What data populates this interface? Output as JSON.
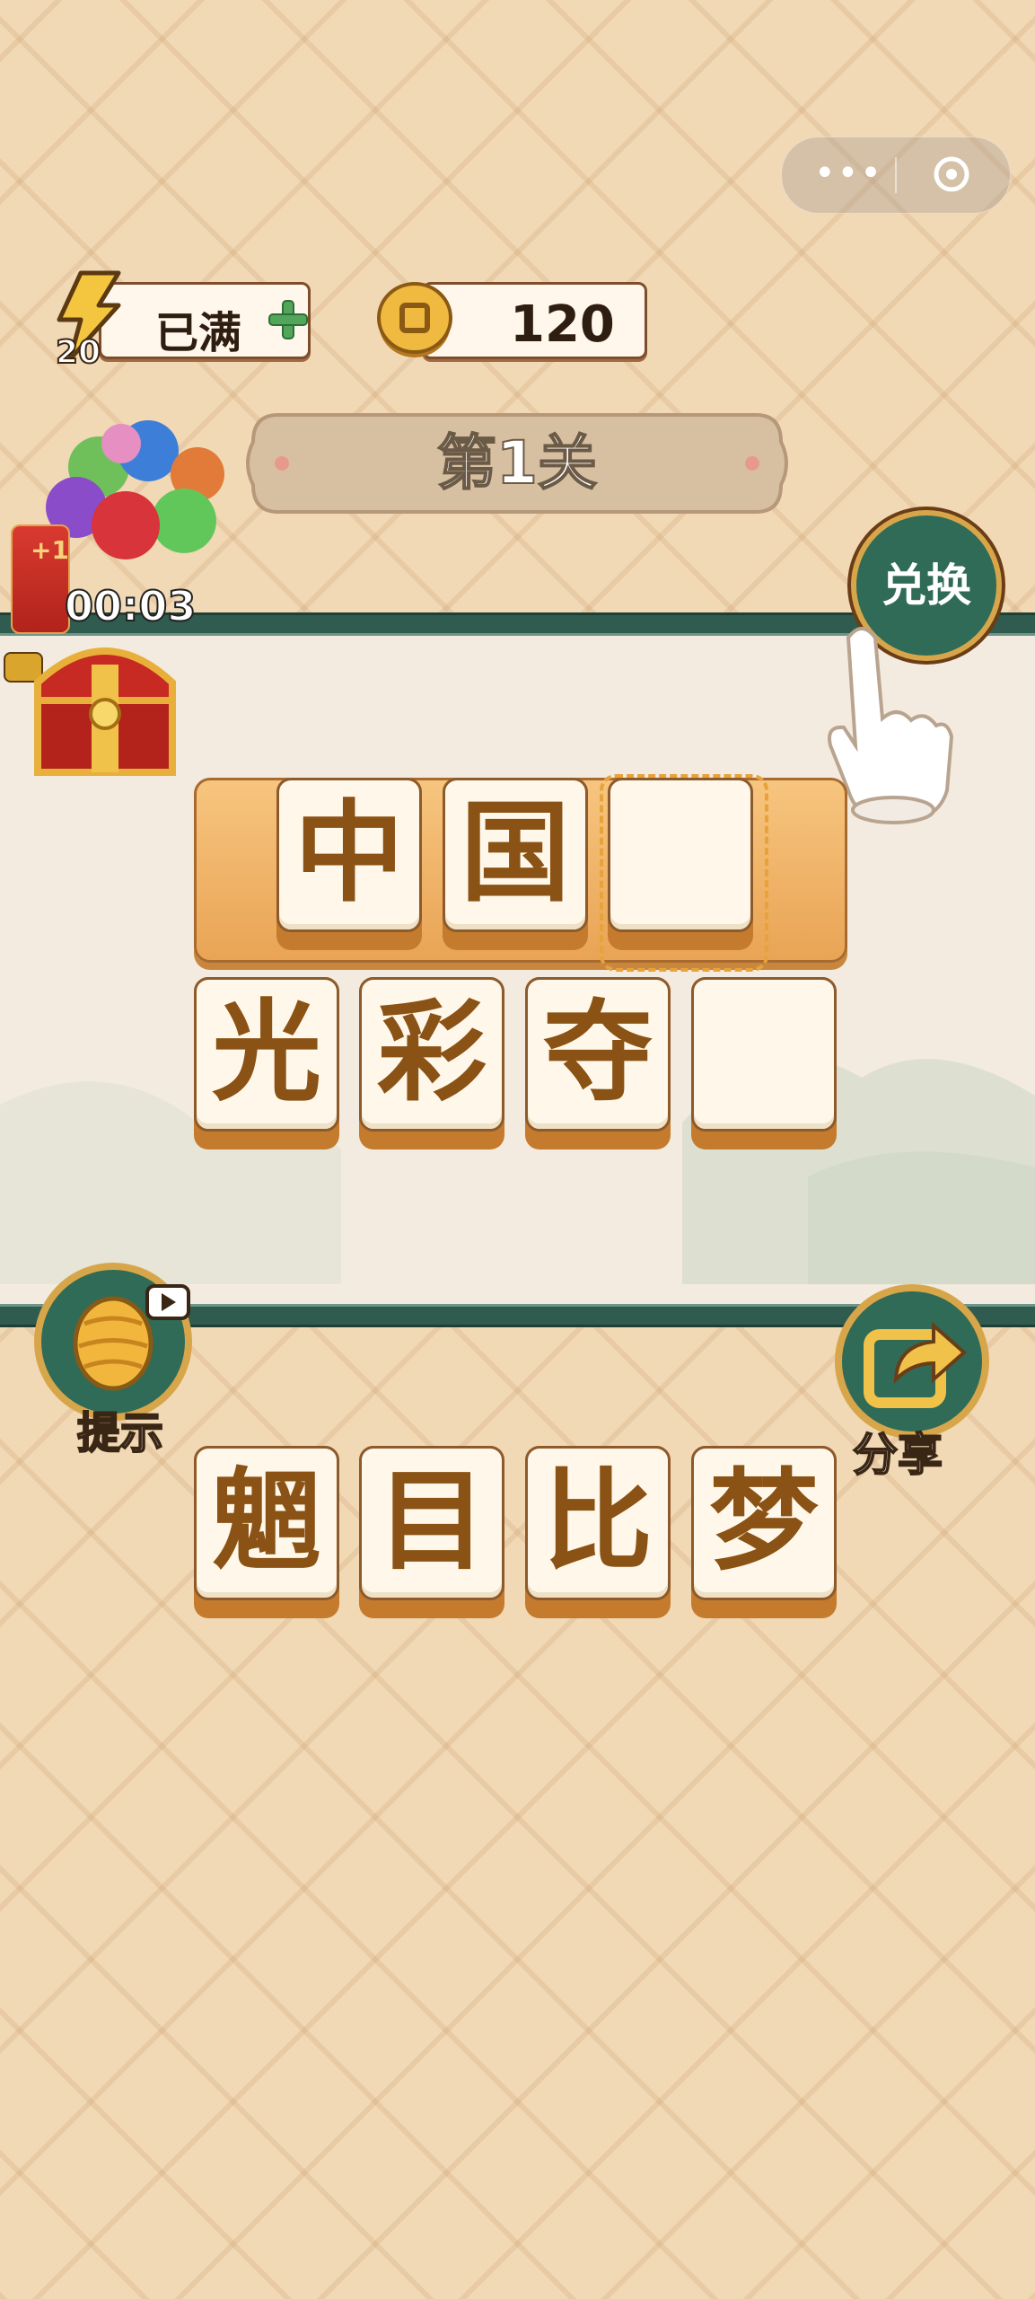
{
  "capsule": {
    "menu_icon": "more-dots-icon",
    "close_icon": "target-icon"
  },
  "energy": {
    "label": "已满",
    "count": "20",
    "icon": "lightning-bolt-icon",
    "add_icon": "plus-icon"
  },
  "coins": {
    "amount": "120",
    "icon": "coin-icon"
  },
  "level": {
    "title": "第1关"
  },
  "rewards": {
    "timer": "00:03",
    "redpack_text": "+1",
    "balloons_icon": "balloons-icon",
    "chest_icon": "treasure-chest-icon"
  },
  "buttons": {
    "exchange": "兑换",
    "hint": "提示",
    "share": "分享"
  },
  "answer_row": {
    "tiles": [
      "中",
      "国",
      ""
    ]
  },
  "second_row": {
    "tiles": [
      "光",
      "彩",
      "夺",
      ""
    ]
  },
  "choices": {
    "tiles": [
      "魍",
      "目",
      "比",
      "梦"
    ]
  },
  "colors": {
    "accent_green": "#2f6b57",
    "tile_text": "#8a5215",
    "gold": "#d8a64a"
  }
}
